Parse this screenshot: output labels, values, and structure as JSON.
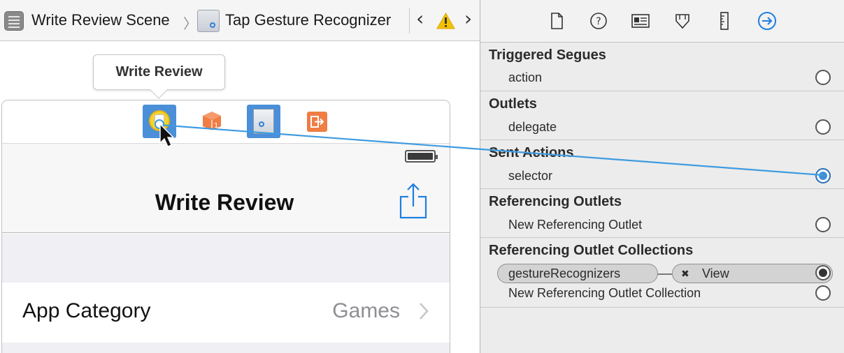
{
  "jumpbar": {
    "scene_label": "Write Review Scene",
    "object_label": "Tap Gesture Recognizer",
    "back_arrow": "‹",
    "forward_arrow": "›",
    "separator": "〉"
  },
  "canvas": {
    "tooltip": "Write Review",
    "navbar_title": "Write Review",
    "cell": {
      "label": "App Category",
      "value": "Games"
    }
  },
  "inspector": {
    "toolbar_icons": [
      "file-inspector-icon",
      "quick-help-icon",
      "identity-inspector-icon",
      "attributes-inspector-icon",
      "size-inspector-icon",
      "connections-inspector-icon"
    ],
    "sections": {
      "triggered_segues": {
        "title": "Triggered Segues",
        "rows": [
          "action"
        ]
      },
      "outlets": {
        "title": "Outlets",
        "rows": [
          "delegate"
        ]
      },
      "sent_actions": {
        "title": "Sent Actions",
        "rows": [
          "selector"
        ]
      },
      "referencing_outlets": {
        "title": "Referencing Outlets",
        "rows": [
          "New Referencing Outlet"
        ]
      },
      "referencing_outlet_collections": {
        "title": "Referencing Outlet Collections",
        "connection": {
          "outlet": "gestureRecognizers",
          "target": "View",
          "remove_glyph": "✖"
        },
        "rows": [
          "New Referencing Outlet Collection"
        ]
      }
    }
  },
  "colors": {
    "accent": "#1f7ee0",
    "connection_line": "#3f9be0",
    "warning": "#f2c200",
    "dock_highlight": "#4a8fd8",
    "exit_orange": "#ef7d44"
  }
}
